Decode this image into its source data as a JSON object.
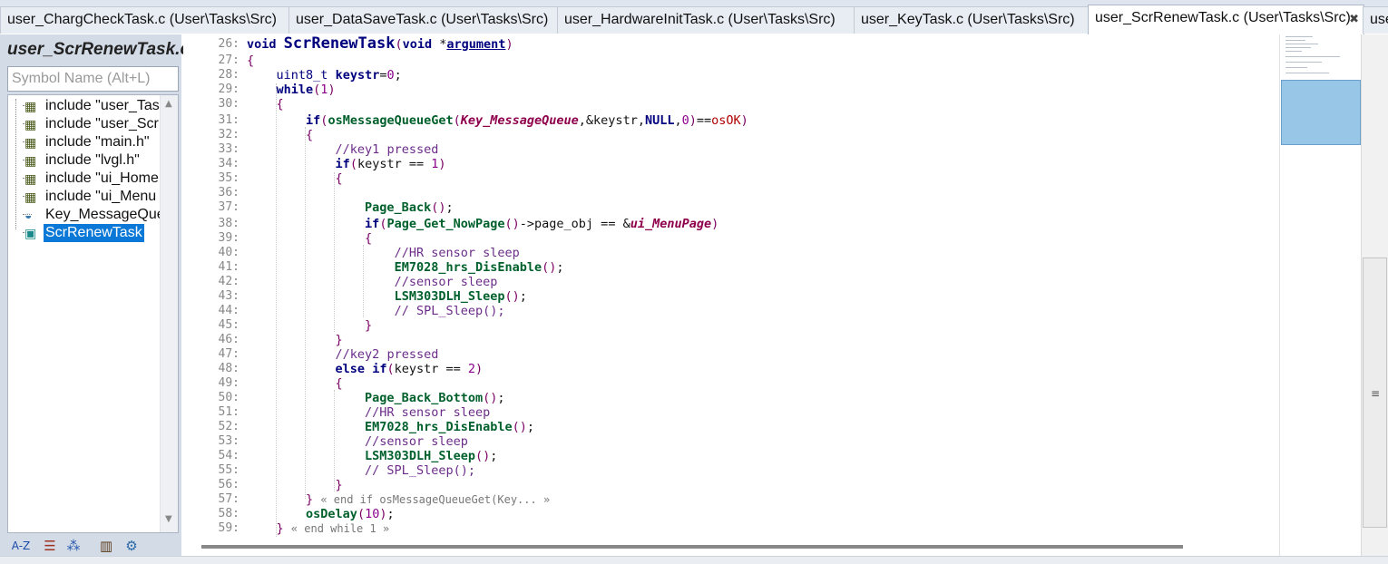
{
  "tabs": [
    {
      "label": "user_ChargCheckTask.c (User\\Tasks\\Src)"
    },
    {
      "label": "user_DataSaveTask.c (User\\Tasks\\Src)"
    },
    {
      "label": "user_HardwareInitTask.c (User\\Tasks\\Src)"
    },
    {
      "label": "user_KeyTask.c (User\\Tasks\\Src)"
    },
    {
      "label": "user_ScrRenewTask.c (User\\Tasks\\Src)"
    },
    {
      "label": "use"
    }
  ],
  "sidebar": {
    "title": "user_ScrRenewTask.c",
    "search_placeholder": "Symbol Name (Alt+L)",
    "items": [
      {
        "label": "include \"user_Tas"
      },
      {
        "label": "include \"user_Scr"
      },
      {
        "label": "include \"main.h\""
      },
      {
        "label": "include \"lvgl.h\""
      },
      {
        "label": "include \"ui_Home"
      },
      {
        "label": "include \"ui_Menu"
      },
      {
        "label": "Key_MessageQue"
      },
      {
        "label": "ScrRenewTask"
      }
    ],
    "tools": [
      {
        "icon": "az-sort-icon"
      },
      {
        "icon": "list-view-icon"
      },
      {
        "icon": "category-icon"
      },
      {
        "icon": "book-icon"
      },
      {
        "icon": "gear-icon"
      }
    ]
  },
  "editor": {
    "colors": {
      "keyword": "#00007f",
      "function": "#00602b",
      "comment": "#6b2c8a",
      "number": "#8b008b",
      "global": "#8f004c",
      "selection": "#0a78d6"
    },
    "lines": [
      {
        "num": "26:",
        "t": "void ScrRenewTask(void *argument)"
      },
      {
        "num": "27:",
        "t": "{"
      },
      {
        "num": "28:",
        "t": "    uint8_t keystr=0;"
      },
      {
        "num": "29:",
        "t": "    while(1)"
      },
      {
        "num": "30:",
        "t": "    {"
      },
      {
        "num": "31:",
        "t": "        if(osMessageQueueGet(Key_MessageQueue,&keystr,NULL,0)==osOK)"
      },
      {
        "num": "32:",
        "t": "        {"
      },
      {
        "num": "33:",
        "t": "            //key1 pressed"
      },
      {
        "num": "34:",
        "t": "            if(keystr == 1)"
      },
      {
        "num": "35:",
        "t": "            {"
      },
      {
        "num": "36:",
        "t": ""
      },
      {
        "num": "37:",
        "t": "                Page_Back();"
      },
      {
        "num": "38:",
        "t": "                if(Page_Get_NowPage()->page_obj == &ui_MenuPage)"
      },
      {
        "num": "39:",
        "t": "                {"
      },
      {
        "num": "40:",
        "t": "                    //HR sensor sleep"
      },
      {
        "num": "41:",
        "t": "                    EM7028_hrs_DisEnable();"
      },
      {
        "num": "42:",
        "t": "                    //sensor sleep"
      },
      {
        "num": "43:",
        "t": "                    LSM303DLH_Sleep();"
      },
      {
        "num": "44:",
        "t": "                    // SPL_Sleep();"
      },
      {
        "num": "45:",
        "t": "                }"
      },
      {
        "num": "46:",
        "t": "            }"
      },
      {
        "num": "47:",
        "t": "            //key2 pressed"
      },
      {
        "num": "48:",
        "t": "            else if(keystr == 2)"
      },
      {
        "num": "49:",
        "t": "            {"
      },
      {
        "num": "50:",
        "t": "                Page_Back_Bottom();"
      },
      {
        "num": "51:",
        "t": "                //HR sensor sleep"
      },
      {
        "num": "52:",
        "t": "                EM7028_hrs_DisEnable();"
      },
      {
        "num": "53:",
        "t": "                //sensor sleep"
      },
      {
        "num": "54:",
        "t": "                LSM303DLH_Sleep();"
      },
      {
        "num": "55:",
        "t": "                // SPL_Sleep();"
      },
      {
        "num": "56:",
        "t": "            }"
      },
      {
        "num": "57:",
        "t": "        } « end if osMessageQueueGet(Key... »"
      },
      {
        "num": "58:",
        "t": "        osDelay(10);"
      },
      {
        "num": "59:",
        "t": "    } « end while 1 »"
      }
    ]
  }
}
